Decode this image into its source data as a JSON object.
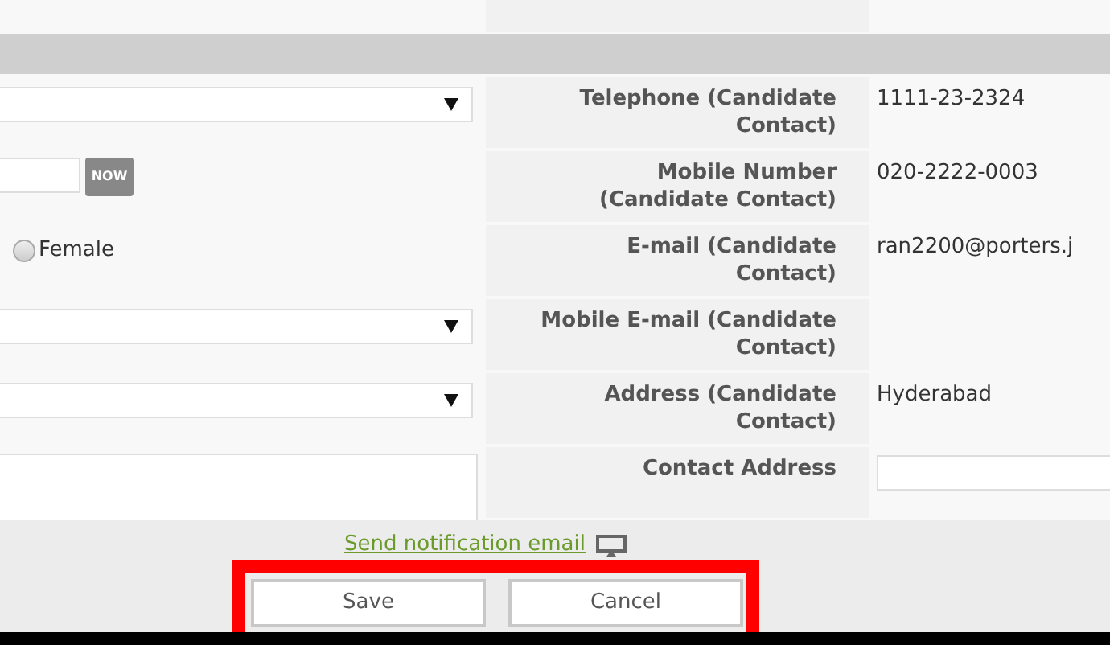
{
  "left_fields": [
    {
      "kind": "select"
    },
    {
      "kind": "date",
      "button": "NOW"
    },
    {
      "kind": "radio",
      "label": "Female",
      "selected": false
    },
    {
      "kind": "select"
    },
    {
      "kind": "select"
    },
    {
      "kind": "textarea"
    }
  ],
  "contact_fields": [
    {
      "label": "Telephone (Candidate Contact)",
      "kind": "text",
      "value": "1111-23-2324"
    },
    {
      "label": "Mobile Number (Candidate Contact)",
      "kind": "text",
      "value": "020-2222-0003"
    },
    {
      "label": "E-mail (Candidate Contact)",
      "kind": "text",
      "value": "ran2200@porters.j"
    },
    {
      "label": "Mobile E-mail (Candidate Contact)",
      "kind": "text"
    },
    {
      "label": "Address (Candidate Contact)",
      "kind": "text",
      "value": "Hyderabad"
    },
    {
      "label": "Contact Address",
      "kind": "input"
    }
  ],
  "footer": {
    "link": "Send notification email",
    "buttons_highlighted": true,
    "buttons": [
      "Save",
      "Cancel"
    ]
  }
}
